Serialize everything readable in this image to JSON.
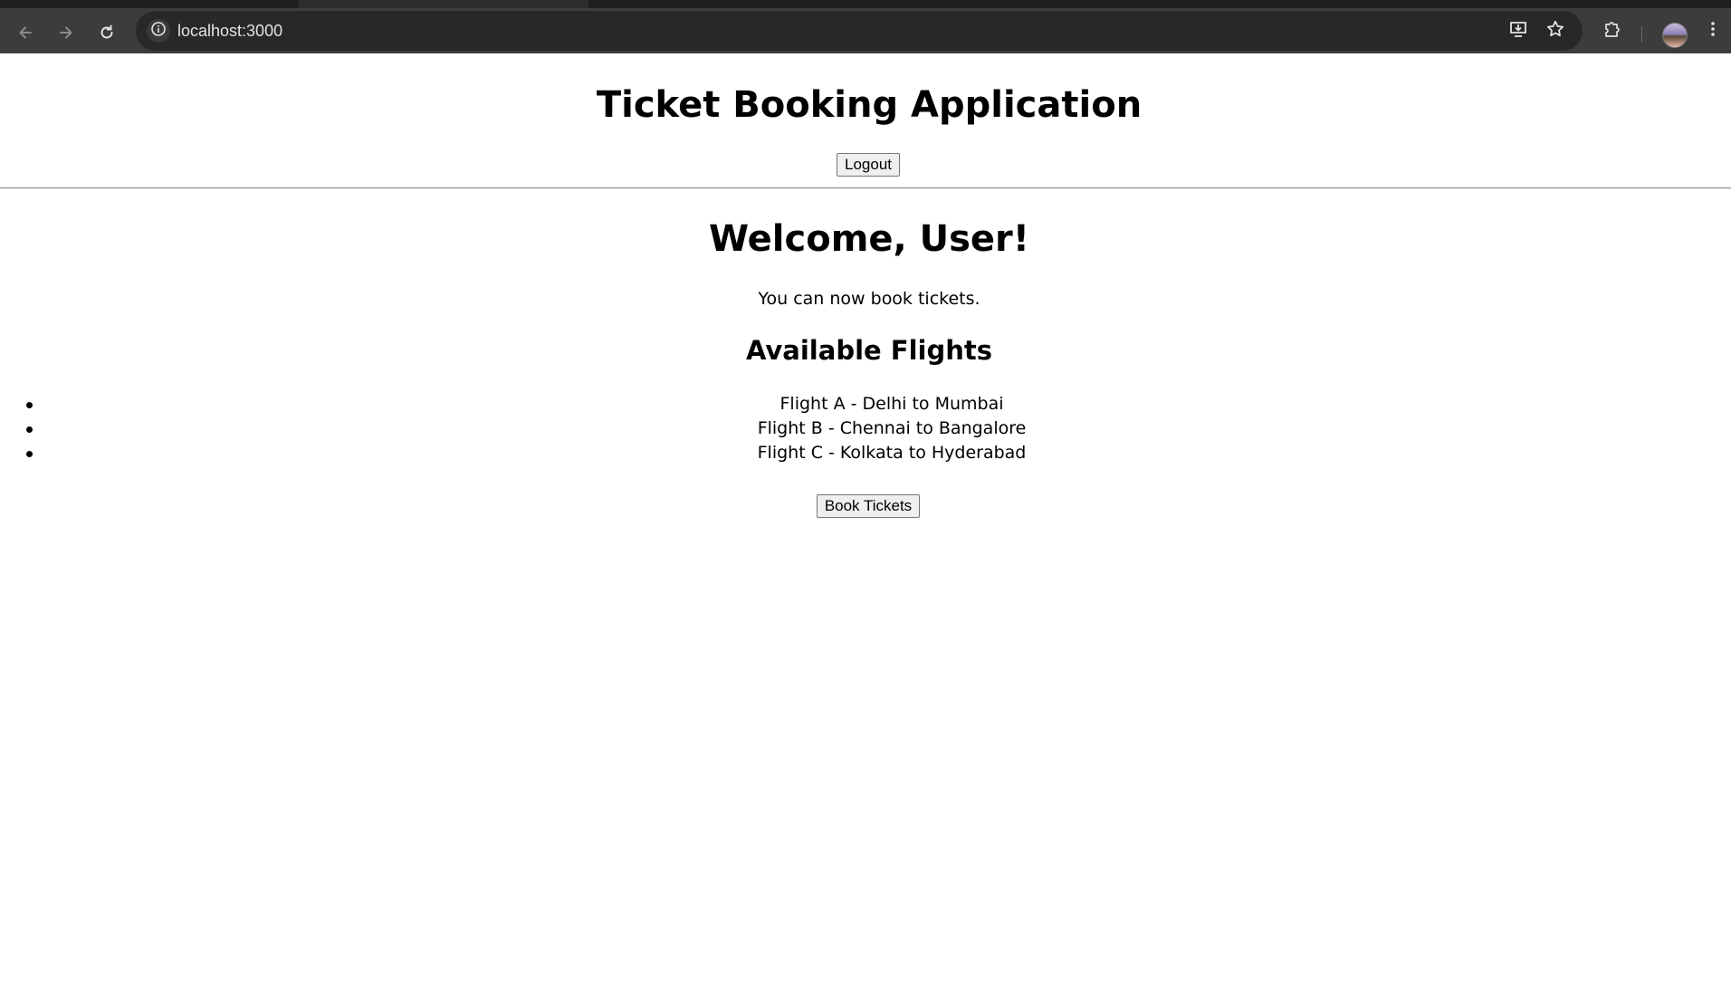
{
  "browser": {
    "url": "localhost:3000",
    "icons": {
      "back": "arrow-left-icon",
      "forward": "arrow-right-icon",
      "reload": "reload-icon",
      "site_info": "info-icon",
      "install": "install-app-icon",
      "bookmark": "star-icon",
      "extensions": "puzzle-icon",
      "profile": "avatar",
      "menu": "kebab-menu-icon"
    },
    "colors": {
      "chrome_bg": "#3c3c3c",
      "omnibox_bg": "#282828",
      "url_text": "#e3e3e3"
    }
  },
  "page": {
    "title": "Ticket Booking Application",
    "logout_label": "Logout",
    "welcome": "Welcome, User!",
    "subtext": "You can now book tickets.",
    "flights_heading": "Available Flights",
    "flights": [
      "Flight A - Delhi to Mumbai",
      "Flight B - Chennai to Bangalore",
      "Flight C - Kolkata to Hyderabad"
    ],
    "book_label": "Book Tickets"
  }
}
